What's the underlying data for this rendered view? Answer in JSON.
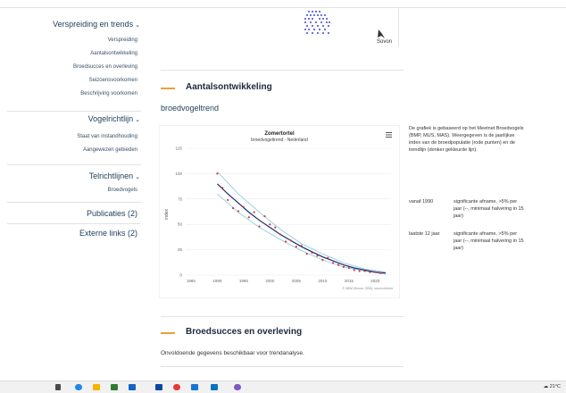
{
  "sidebar": {
    "sections": [
      {
        "title": "Verspreiding en trends",
        "items": [
          "Verspreiding",
          "Aantalsontwikkeling",
          "Broedsucces en overleving",
          "Seizoensvoorkomen",
          "Beschrijving voorkomen"
        ]
      },
      {
        "title": "Vogelrichtlijn",
        "items": [
          "Staat van instandhouding",
          "Aangewezen gebieden"
        ]
      },
      {
        "title": "Telrichtlijnen",
        "items": [
          "Broedvogels"
        ]
      }
    ],
    "links": [
      "Publicaties (2)",
      "Externe links (2)"
    ]
  },
  "header": {
    "logo_text": "Sovon"
  },
  "main": {
    "section1_title": "Aantalsontwikkeling",
    "subtitle": "broedvogeltrend",
    "description": "De grafiek is gebaseerd op het Meetnet Broedvogels (BMP, MUS, MAS). Weergegeven is de jaarlijkse index van de broedpopulatie (rode punten) en de trendlijn (donker gekleurde lijn).",
    "significance": [
      {
        "label": "vanaf 1990",
        "value": "significante afname, >5% per jaar (--, minimaal halvering in 15 jaar)"
      },
      {
        "label": "laatste 12 jaar",
        "value": "significante afname, >5% per jaar (--, minimaal halvering in 15 jaar)"
      }
    ],
    "section2_title": "Broedsucces en overleving",
    "section2_text": "Onvoldoende gegevens beschikbaar voor trendanalyse."
  },
  "taskbar": {
    "weather": "21°C"
  },
  "colors": {
    "accent": "#e8a23a",
    "index_points": "#e0303a",
    "trend_line": "#1a2a6e",
    "band": "#8fd0dc"
  },
  "chart_data": {
    "type": "line",
    "title": "Zomertortel",
    "subtitle": "broedvogeltrend - Nederland",
    "ylabel": "index",
    "xlabel": "",
    "xlim": [
      1984,
      2023
    ],
    "ylim": [
      0,
      125
    ],
    "y_ticks": [
      0,
      25,
      50,
      75,
      100,
      125
    ],
    "x_ticks": [
      1985,
      1990,
      1995,
      2000,
      2005,
      2010,
      2015,
      2020
    ],
    "credit": "© NEM (Sovon, CBS), sovon.nl/nem",
    "series": [
      {
        "name": "index",
        "kind": "points",
        "x": [
          1990,
          1991,
          1992,
          1993,
          1994,
          1995,
          1996,
          1997,
          1998,
          1999,
          2000,
          2001,
          2002,
          2003,
          2004,
          2005,
          2006,
          2007,
          2008,
          2009,
          2010,
          2011,
          2012,
          2013,
          2014,
          2015,
          2016,
          2017,
          2018,
          2019,
          2020,
          2021
        ],
        "y": [
          100,
          86,
          74,
          66,
          63,
          67,
          57,
          62,
          48,
          58,
          50,
          47,
          40,
          33,
          34,
          28,
          29,
          21,
          22,
          19,
          15,
          17,
          12,
          10,
          8,
          7,
          5,
          4,
          4,
          3,
          3,
          2
        ]
      },
      {
        "name": "trend",
        "kind": "line",
        "x": [
          1990,
          1992,
          1994,
          1996,
          1998,
          2000,
          2002,
          2004,
          2006,
          2008,
          2010,
          2012,
          2014,
          2016,
          2018,
          2020,
          2022
        ],
        "y": [
          90,
          80,
          71,
          62,
          54,
          47,
          40,
          34,
          28,
          23,
          18,
          14,
          10,
          7,
          5,
          3,
          2
        ]
      },
      {
        "name": "band_upper",
        "kind": "line",
        "x": [
          1990,
          1994,
          1998,
          2002,
          2006,
          2010,
          2014,
          2018,
          2022
        ],
        "y": [
          102,
          80,
          62,
          45,
          31,
          21,
          12,
          6,
          3
        ]
      },
      {
        "name": "band_lower",
        "kind": "line",
        "x": [
          1990,
          1994,
          1998,
          2002,
          2006,
          2010,
          2014,
          2018,
          2022
        ],
        "y": [
          80,
          62,
          47,
          35,
          24,
          15,
          8,
          4,
          1
        ]
      }
    ]
  }
}
